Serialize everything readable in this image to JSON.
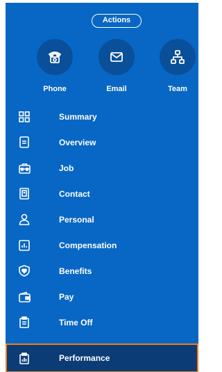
{
  "actions": {
    "label": "Actions"
  },
  "quick_actions": [
    {
      "label": "Phone",
      "icon": "phone-icon"
    },
    {
      "label": "Email",
      "icon": "email-icon"
    },
    {
      "label": "Team",
      "icon": "team-icon"
    }
  ],
  "nav": {
    "items": [
      {
        "label": "Summary",
        "icon": "grid-icon"
      },
      {
        "label": "Overview",
        "icon": "document-icon"
      },
      {
        "label": "Job",
        "icon": "briefcase-icon"
      },
      {
        "label": "Contact",
        "icon": "contact-card-icon"
      },
      {
        "label": "Personal",
        "icon": "person-icon"
      },
      {
        "label": "Compensation",
        "icon": "chart-icon"
      },
      {
        "label": "Benefits",
        "icon": "shield-heart-icon"
      },
      {
        "label": "Pay",
        "icon": "wallet-icon"
      },
      {
        "label": "Time Off",
        "icon": "clipboard-icon"
      },
      {
        "label": "Performance",
        "icon": "clipboard-chart-icon",
        "selected": true
      }
    ]
  },
  "colors": {
    "panel": "#0867c4",
    "circle": "#0a4f99",
    "selected_bg": "#0b3c76",
    "selected_border": "#f07f1c",
    "text": "#ffffff"
  }
}
